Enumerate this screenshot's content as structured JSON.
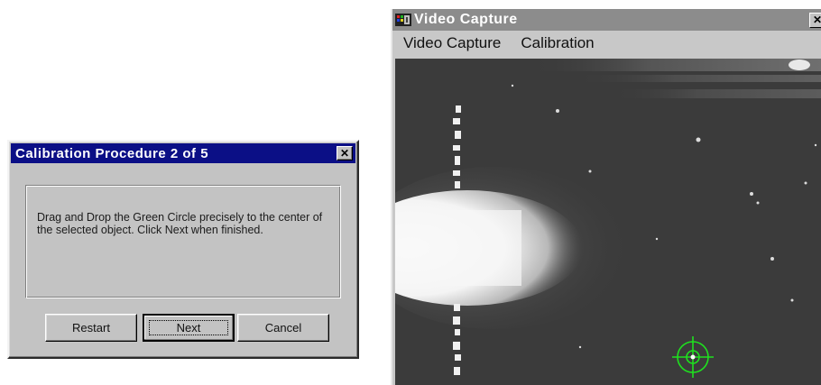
{
  "dialog": {
    "title": "Calibration Procedure 2 of 5",
    "close_glyph": "✕",
    "message": "Drag and Drop the Green Circle precisely to the center of the selected object. Click Next when finished.",
    "buttons": {
      "restart": "Restart",
      "next": "Next",
      "cancel": "Cancel"
    }
  },
  "video_window": {
    "title": "Video Capture",
    "close_glyph": "✕",
    "menu": [
      "Video Capture",
      "Calibration"
    ],
    "icon": "video-capture-app-icon",
    "marker_color": "#1fe01f"
  }
}
